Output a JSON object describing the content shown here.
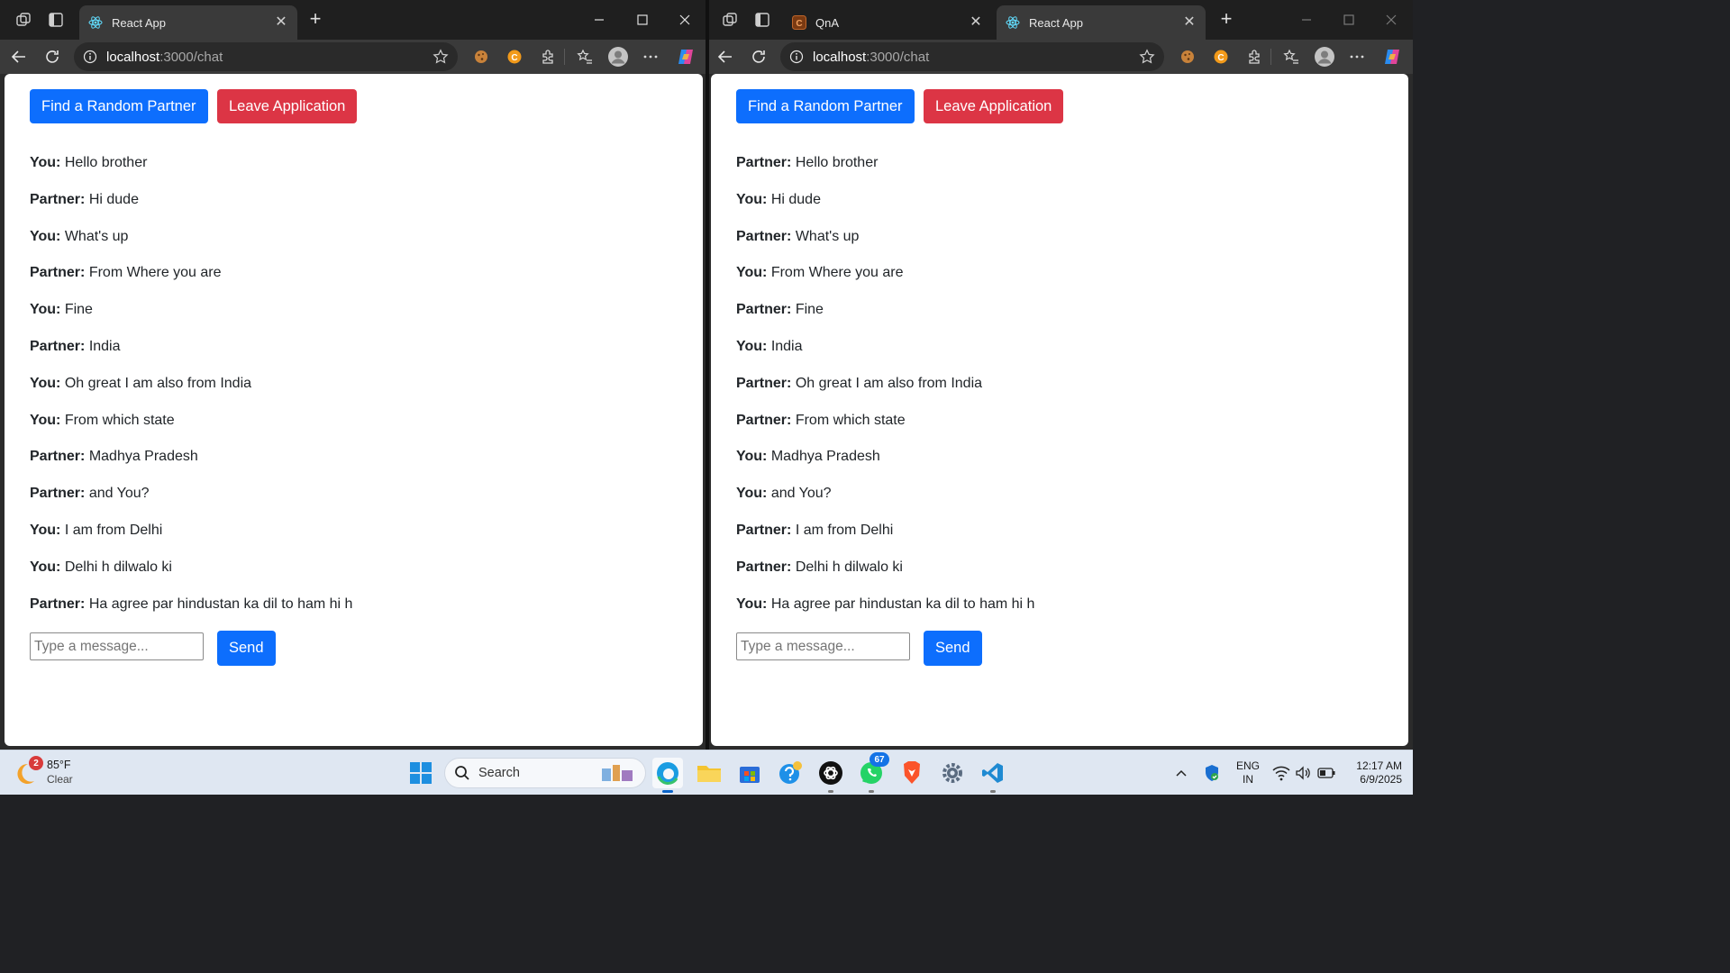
{
  "windows": [
    {
      "tabs": [
        {
          "title": "React App",
          "active": true
        }
      ],
      "url": {
        "host": "localhost",
        "rest": ":3000/chat"
      },
      "buttons": {
        "find_partner": "Find a Random Partner",
        "leave": "Leave Application",
        "send": "Send"
      },
      "input_placeholder": "Type a message...",
      "messages": [
        {
          "sender": "You:",
          "text": "Hello brother"
        },
        {
          "sender": "Partner:",
          "text": "Hi dude"
        },
        {
          "sender": "You:",
          "text": "What's up"
        },
        {
          "sender": "Partner:",
          "text": "From Where you are"
        },
        {
          "sender": "You:",
          "text": "Fine"
        },
        {
          "sender": "Partner:",
          "text": "India"
        },
        {
          "sender": "You:",
          "text": "Oh great I am also from India"
        },
        {
          "sender": "You:",
          "text": "From which state"
        },
        {
          "sender": "Partner:",
          "text": "Madhya Pradesh"
        },
        {
          "sender": "Partner:",
          "text": "and You?"
        },
        {
          "sender": "You:",
          "text": "I am from Delhi"
        },
        {
          "sender": "You:",
          "text": "Delhi h dilwalo ki"
        },
        {
          "sender": "Partner:",
          "text": "Ha agree par hindustan ka dil to ham hi h"
        }
      ]
    },
    {
      "tabs": [
        {
          "title": "QnA",
          "active": false
        },
        {
          "title": "React App",
          "active": true
        }
      ],
      "url": {
        "host": "localhost",
        "rest": ":3000/chat"
      },
      "buttons": {
        "find_partner": "Find a Random Partner",
        "leave": "Leave Application",
        "send": "Send"
      },
      "input_placeholder": "Type a message...",
      "messages": [
        {
          "sender": "Partner:",
          "text": "Hello brother"
        },
        {
          "sender": "You:",
          "text": "Hi dude"
        },
        {
          "sender": "Partner:",
          "text": "What's up"
        },
        {
          "sender": "You:",
          "text": "From Where you are"
        },
        {
          "sender": "Partner:",
          "text": "Fine"
        },
        {
          "sender": "You:",
          "text": "India"
        },
        {
          "sender": "Partner:",
          "text": "Oh great I am also from India"
        },
        {
          "sender": "Partner:",
          "text": "From which state"
        },
        {
          "sender": "You:",
          "text": "Madhya Pradesh"
        },
        {
          "sender": "You:",
          "text": "and You?"
        },
        {
          "sender": "Partner:",
          "text": "I am from Delhi"
        },
        {
          "sender": "Partner:",
          "text": "Delhi h dilwalo ki"
        },
        {
          "sender": "You:",
          "text": "Ha agree par hindustan ka dil to ham hi h"
        }
      ]
    }
  ],
  "colors": {
    "primary": "#0d6efd",
    "danger": "#dc3545"
  },
  "taskbar": {
    "weather": {
      "temp": "85°F",
      "condition": "Clear",
      "badge": "2"
    },
    "search_placeholder": "Search",
    "whatsapp_badge": "67",
    "tray": {
      "lang_top": "ENG",
      "lang_bottom": "IN",
      "time": "12:17 AM",
      "date": "6/9/2025"
    },
    "apps": [
      "start-icon",
      "search-icon",
      "edge-icon",
      "file-explorer-icon",
      "store-icon",
      "copilot-icon",
      "chatgpt-icon",
      "whatsapp-icon",
      "brave-icon",
      "settings-icon",
      "vscode-icon"
    ]
  }
}
